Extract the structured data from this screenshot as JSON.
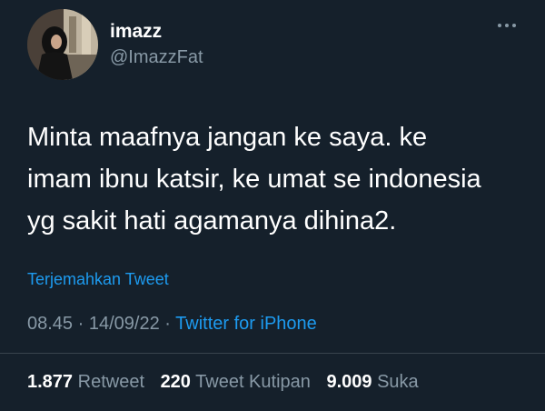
{
  "user": {
    "display_name": "imazz",
    "handle": "@ImazzFat"
  },
  "tweet": {
    "text": "Minta maafnya jangan ke saya. ke\nimam ibnu katsir, ke umat se indonesia\nyg sakit hati agamanya dihina2.",
    "translate_label": "Terjemahkan Tweet",
    "time": "08.45",
    "date": "14/09/22",
    "separator": "·",
    "source": "Twitter for iPhone"
  },
  "stats": {
    "retweets": "1.877",
    "retweets_label": "Retweet",
    "quotes": "220",
    "quotes_label": "Tweet Kutipan",
    "likes": "9.009",
    "likes_label": "Suka"
  },
  "icons": {
    "more": "more-horizontal-icon"
  },
  "colors": {
    "background": "#15202b",
    "accent": "#1d9bf0",
    "muted": "#8899a6"
  }
}
